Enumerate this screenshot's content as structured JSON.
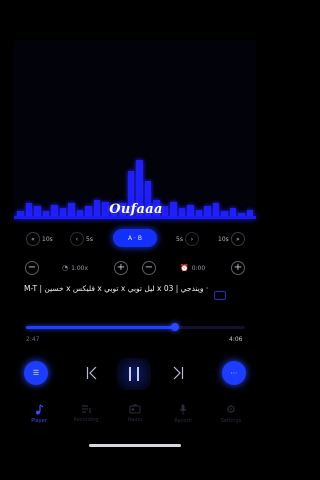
{
  "visualizer": {
    "logo_text": "Oufaaa",
    "accent": "#1e1eff",
    "bar_levels": [
      0.03,
      0.08,
      0.06,
      0.03,
      0.07,
      0.05,
      0.08,
      0.04,
      0.06,
      0.1,
      0.09,
      0.05,
      0.08,
      0.28,
      0.35,
      0.22,
      0.1,
      0.06,
      0.09,
      0.05,
      0.07,
      0.04,
      0.06,
      0.08,
      0.03,
      0.05,
      0.02,
      0.04
    ]
  },
  "seek": {
    "back_10": "10",
    "back_5": "5",
    "forward_5": "5",
    "forward_10": "10",
    "play_pill_label": "A · B"
  },
  "controls": {
    "speed_value": "1.00x",
    "timer_value": "0:00"
  },
  "track": {
    "title": "M-T | خسين x فليكس x توبي x ليل توبي x ويندجي | 03 ·",
    "elapsed": "2:47",
    "duration": "4:06",
    "progress": 0.68
  },
  "tabs": [
    {
      "label": "Player",
      "icon": "music-note-icon",
      "active": true
    },
    {
      "label": "Recording",
      "icon": "playlist-icon",
      "active": false
    },
    {
      "label": "Radio",
      "icon": "radio-icon",
      "active": false
    },
    {
      "label": "Record",
      "icon": "microphone-icon",
      "active": false
    },
    {
      "label": "Settings",
      "icon": "gear-icon",
      "active": false
    }
  ]
}
